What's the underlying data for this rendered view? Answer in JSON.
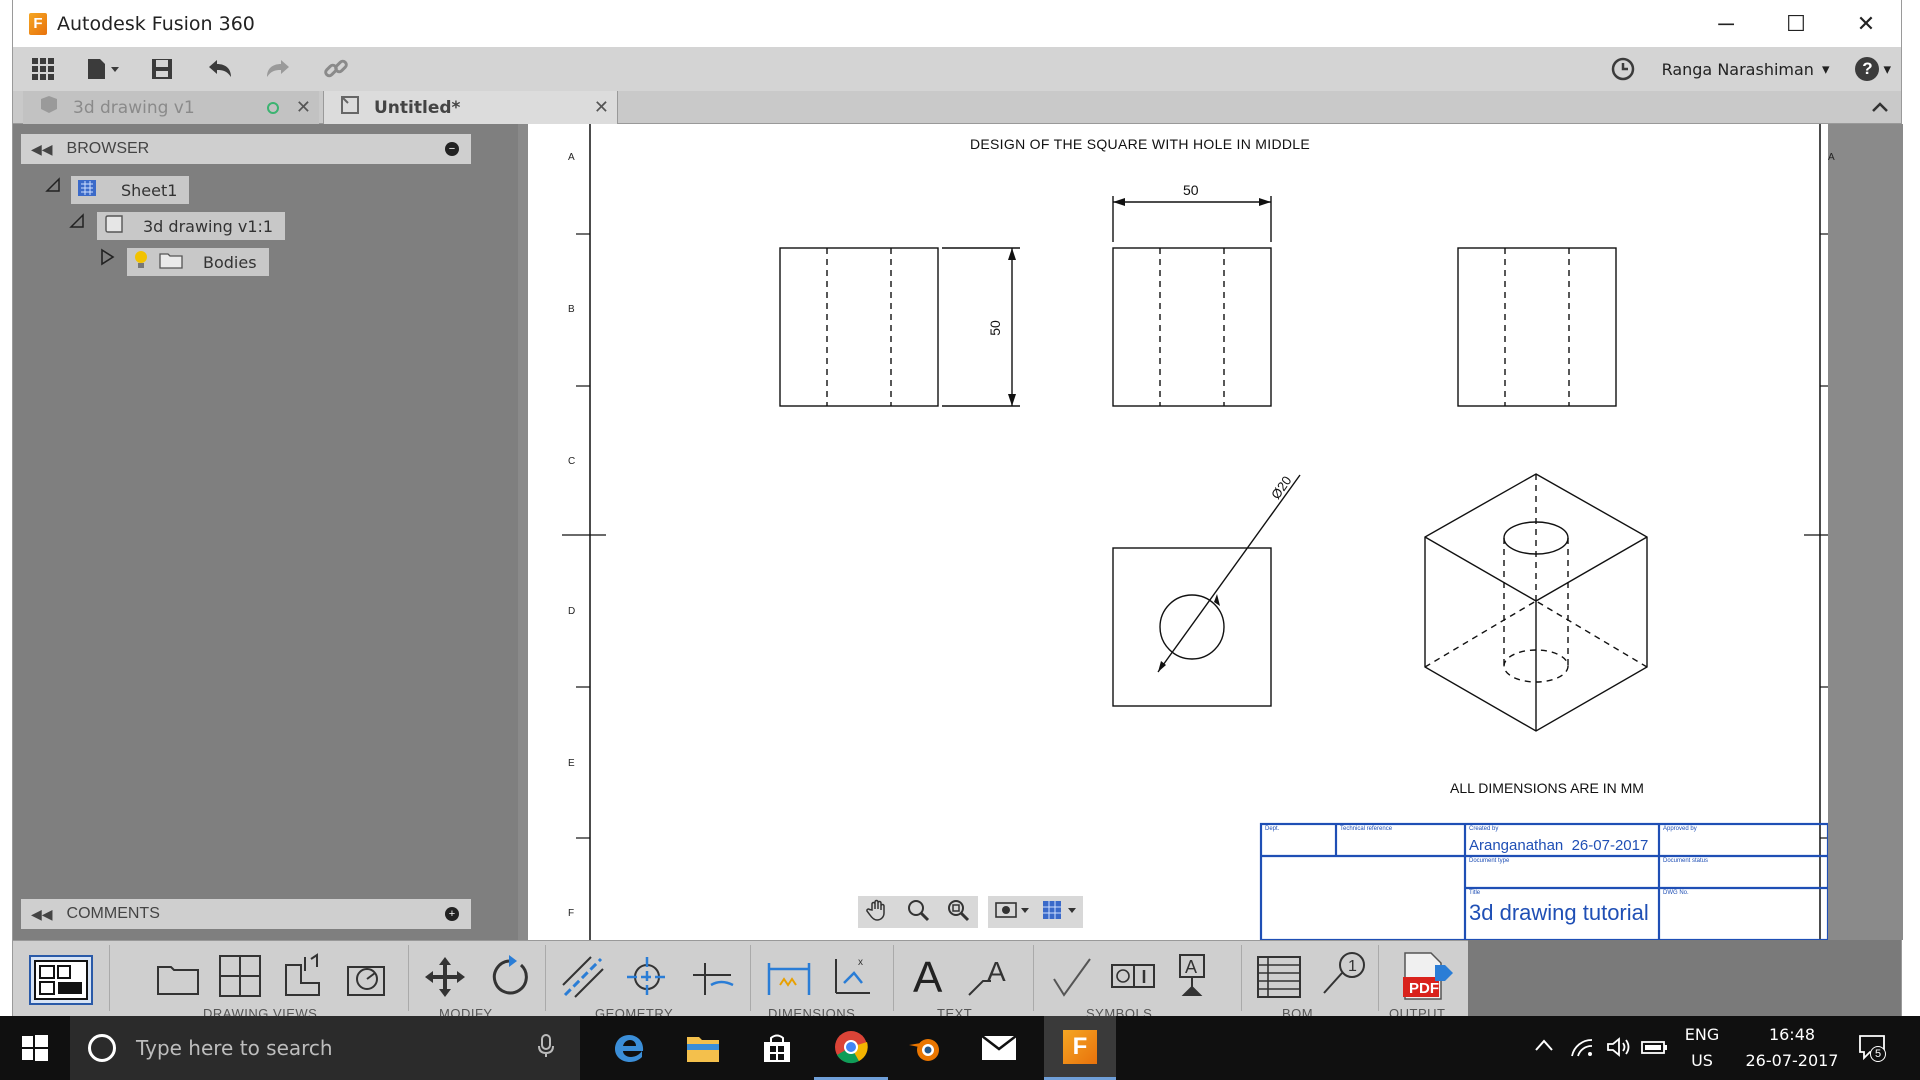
{
  "window": {
    "title": "Autodesk Fusion 360",
    "app_logo_letter": "F",
    "controls": {
      "minimize": "─",
      "maximize": "☐",
      "close": "✕"
    }
  },
  "toolbar": {
    "user_name": "Ranga Narashiman",
    "user_dropdown": "▾",
    "help_label": "?",
    "icons": [
      "grid-icon",
      "file-icon",
      "save-icon",
      "undo-icon",
      "redo-icon",
      "link-icon",
      "clock-icon",
      "help-icon"
    ]
  },
  "tabs": [
    {
      "label": "3d drawing v1",
      "active": false
    },
    {
      "label": "Untitled*",
      "active": true
    }
  ],
  "browser": {
    "header": "BROWSER",
    "nodes": [
      {
        "label": "Sheet1"
      },
      {
        "label": "3d drawing v1:1"
      },
      {
        "label": "Bodies"
      }
    ]
  },
  "comments": {
    "header": "COMMENTS"
  },
  "drawing": {
    "title": "DESIGN OF THE SQUARE WITH HOLE IN MIDDLE",
    "note": "ALL DIMENSIONS ARE IN MM",
    "zone_letters": [
      "A",
      "B",
      "C",
      "D",
      "E",
      "F"
    ],
    "dimensions": {
      "width": "50",
      "height": "50",
      "diameter": "Ø20"
    },
    "title_block": {
      "dept_label": "Dept.",
      "tech_ref_label": "Technical reference",
      "created_by_label": "Created by",
      "created_by": "Aranganathan  26-07-2017",
      "approved_by_label": "Approved by",
      "doc_type_label": "Document type",
      "doc_status_label": "Document status",
      "title_label": "Title",
      "title": "3d drawing tutorial",
      "dwg_no_label": "DWG No."
    }
  },
  "ribbon": {
    "groups": [
      "DRAWING VIEWS",
      "MODIFY",
      "GEOMETRY",
      "DIMENSIONS",
      "TEXT",
      "SYMBOLS",
      "BOM",
      "OUTPUT"
    ],
    "pdf_label": "PDF"
  },
  "taskbar": {
    "search_placeholder": "Type here to search",
    "language": "ENG",
    "region": "US",
    "time": "16:48",
    "date": "26-07-2017",
    "notification_count": "5",
    "app_fusion_letter": "F"
  },
  "colors": {
    "title_block_blue": "#1f4fb5",
    "canvas_bg": "#8a8a8a",
    "panel_bg": "#7f7f7f"
  }
}
